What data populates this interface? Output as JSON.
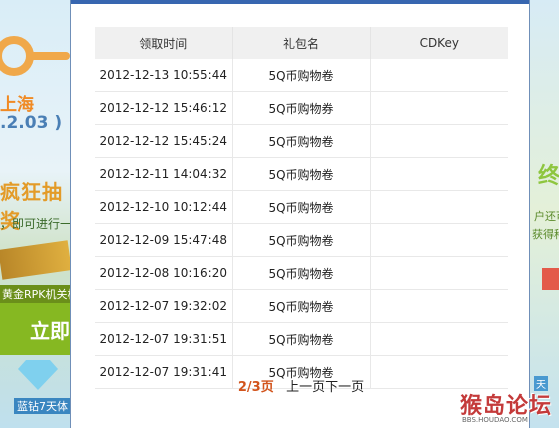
{
  "background_left": {
    "city": "上海",
    "date": ".2.03 )",
    "crazy": "疯狂抽奖",
    "enter": "，即可进行一",
    "prize": "黄金RPK机关枪",
    "go_button": "立即",
    "diamond": "蓝钻7天体"
  },
  "background_right": {
    "end": "终",
    "text1": "户还可",
    "text2": "获得种",
    "heaven": "天"
  },
  "table": {
    "headers": [
      "领取时间",
      "礼包名",
      "CDKey"
    ],
    "rows": [
      {
        "time": "2012-12-13 10:55:44",
        "gift": "5Q币购物卷",
        "cdkey": ""
      },
      {
        "time": "2012-12-12 15:46:12",
        "gift": "5Q币购物券",
        "cdkey": ""
      },
      {
        "time": "2012-12-12 15:45:24",
        "gift": "5Q币购物卷",
        "cdkey": ""
      },
      {
        "time": "2012-12-11 14:04:32",
        "gift": "5Q币购物卷",
        "cdkey": ""
      },
      {
        "time": "2012-12-10 10:12:44",
        "gift": "5Q币购物卷",
        "cdkey": ""
      },
      {
        "time": "2012-12-09 15:47:48",
        "gift": "5Q币购物卷",
        "cdkey": ""
      },
      {
        "time": "2012-12-08 10:16:20",
        "gift": "5Q币购物卷",
        "cdkey": ""
      },
      {
        "time": "2012-12-07 19:32:02",
        "gift": "5Q币购物卷",
        "cdkey": ""
      },
      {
        "time": "2012-12-07 19:31:51",
        "gift": "5Q币购物卷",
        "cdkey": ""
      },
      {
        "time": "2012-12-07 19:31:41",
        "gift": "5Q币购物卷",
        "cdkey": ""
      }
    ]
  },
  "pager": {
    "current": "2/3页",
    "prev": "上一页",
    "next": "下一页"
  },
  "watermark": {
    "text": "猴岛论坛",
    "url": "BBS.HOUDAO.COM"
  },
  "colors": {
    "modal_top_bar": "#3766b0",
    "header_bg": "#f0f0f0",
    "current_page": "#d2541c"
  }
}
